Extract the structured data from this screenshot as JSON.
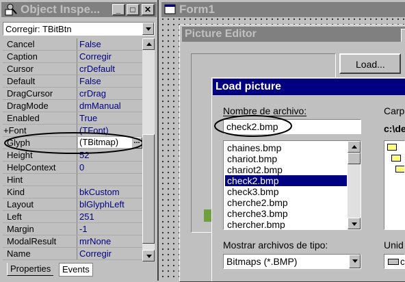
{
  "inspector": {
    "title": "Object Inspe...",
    "selected_component": "Corregir: TBitBtn",
    "properties": [
      {
        "name": "Cancel",
        "value": "False"
      },
      {
        "name": "Caption",
        "value": "Corregir"
      },
      {
        "name": "Cursor",
        "value": "crDefault"
      },
      {
        "name": "Default",
        "value": "False"
      },
      {
        "name": "DragCursor",
        "value": "crDrag"
      },
      {
        "name": "DragMode",
        "value": "dmManual"
      },
      {
        "name": "Enabled",
        "value": "True"
      },
      {
        "name": "+Font",
        "value": "(TFont)"
      },
      {
        "name": "Glyph",
        "value": "(TBitmap)"
      },
      {
        "name": "Height",
        "value": "52"
      },
      {
        "name": "HelpContext",
        "value": "0"
      },
      {
        "name": "Hint",
        "value": ""
      },
      {
        "name": "Kind",
        "value": "bkCustom"
      },
      {
        "name": "Layout",
        "value": "blGlyphLeft"
      },
      {
        "name": "Left",
        "value": "251"
      },
      {
        "name": "Margin",
        "value": "-1"
      },
      {
        "name": "ModalResult",
        "value": "mrNone"
      },
      {
        "name": "Name",
        "value": "Corregir"
      }
    ],
    "ellipsis_label": "...",
    "tabs": [
      "Properties",
      "Events"
    ]
  },
  "form": {
    "title": "Form1"
  },
  "picture_editor": {
    "title": "Picture Editor",
    "load_button": "Load..."
  },
  "load_picture": {
    "title": "Load picture",
    "filename_label": "Nombre de archivo:",
    "filename_value": "check2.bmp",
    "files": [
      "chaines.bmp",
      "chariot.bmp",
      "chariot2.bmp",
      "check2.bmp",
      "check3.bmp",
      "cherche2.bmp",
      "cherche3.bmp",
      "chercher.bmp"
    ],
    "selected_file": "check2.bmp",
    "folders_label": "Carp",
    "current_path": "c:\\de",
    "filetype_label": "Mostrar archivos de tipo:",
    "filetype_value": "Bitmaps (*.BMP)",
    "drives_label": "Unid",
    "drive_value": "c"
  }
}
